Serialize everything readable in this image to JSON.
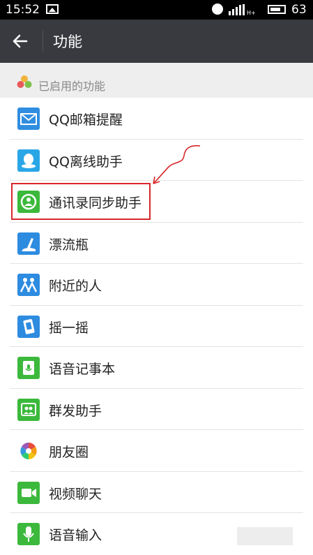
{
  "status": {
    "time": "15:52",
    "battery": "63"
  },
  "topbar": {
    "title": "功能"
  },
  "section": {
    "label": "已启用的功能"
  },
  "items": [
    {
      "label": "QQ邮箱提醒",
      "icon": "mail-icon",
      "color": "#2f8ee0"
    },
    {
      "label": "QQ离线助手",
      "icon": "qq-penguin-icon",
      "color": "#2aa6e7"
    },
    {
      "label": "通讯录同步助手",
      "icon": "contacts-sync-icon",
      "color": "#3cb93c"
    },
    {
      "label": "漂流瓶",
      "icon": "drift-bottle-icon",
      "color": "#2d8be0"
    },
    {
      "label": "附近的人",
      "icon": "people-nearby-icon",
      "color": "#2d8be0"
    },
    {
      "label": "摇一摇",
      "icon": "shake-phone-icon",
      "color": "#2d8be0"
    },
    {
      "label": "语音记事本",
      "icon": "voice-notepad-icon",
      "color": "#3cb93c"
    },
    {
      "label": "群发助手",
      "icon": "broadcast-icon",
      "color": "#3cb93c"
    },
    {
      "label": "朋友圈",
      "icon": "moments-icon",
      "color": "#ffffff"
    },
    {
      "label": "视频聊天",
      "icon": "video-chat-icon",
      "color": "#3cb93c"
    },
    {
      "label": "语音输入",
      "icon": "microphone-icon",
      "color": "#3cb93c"
    }
  ],
  "colors": {
    "topbar": "#393a3f",
    "highlight": "#d9262b"
  }
}
